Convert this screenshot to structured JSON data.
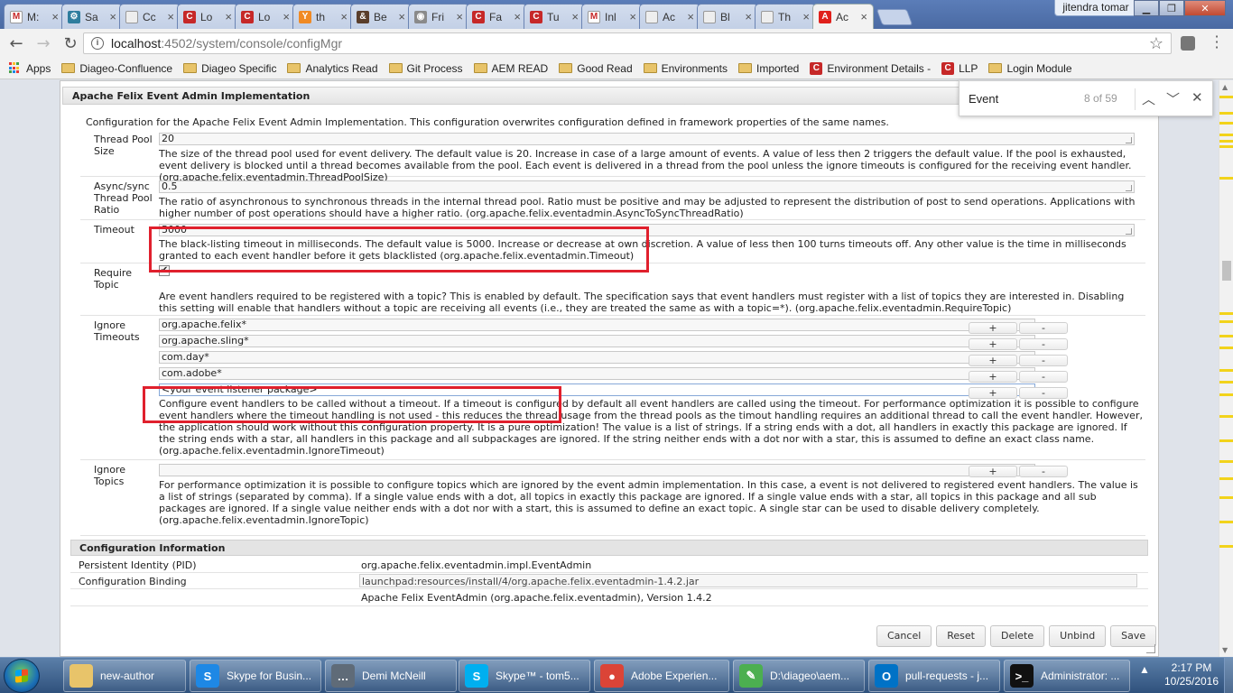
{
  "browser": {
    "tabs": [
      {
        "title": "M:",
        "fav": "gmail-icon",
        "color": "#ffffff",
        "glyph": "M"
      },
      {
        "title": "Sa",
        "fav": "gear-icon",
        "color": "#2e7d9e",
        "glyph": "⚙"
      },
      {
        "title": "Cc",
        "fav": "page-icon",
        "color": "#eeeeee",
        "glyph": ""
      },
      {
        "title": "Lo",
        "fav": "confluence-icon",
        "color": "#c62828",
        "glyph": "C"
      },
      {
        "title": "Lo",
        "fav": "confluence-icon",
        "color": "#c62828",
        "glyph": "C"
      },
      {
        "title": "th",
        "fav": "ycombinator-icon",
        "color": "#f08a24",
        "glyph": "Y"
      },
      {
        "title": "Be",
        "fav": "ampersand-icon",
        "color": "#5a3e2b",
        "glyph": "&"
      },
      {
        "title": "Fri",
        "fav": "eye-icon",
        "color": "#8a8a8a",
        "glyph": "◉"
      },
      {
        "title": "Fa",
        "fav": "confluence-icon",
        "color": "#c62828",
        "glyph": "C"
      },
      {
        "title": "Tu",
        "fav": "confluence-icon",
        "color": "#c62828",
        "glyph": "C"
      },
      {
        "title": "Inl",
        "fav": "gmail-icon",
        "color": "#ffffff",
        "glyph": "M"
      },
      {
        "title": "Ac",
        "fav": "page-icon",
        "color": "#eeeeee",
        "glyph": ""
      },
      {
        "title": "Bl",
        "fav": "page-icon",
        "color": "#eeeeee",
        "glyph": ""
      },
      {
        "title": "Th",
        "fav": "page-icon",
        "color": "#eeeeee",
        "glyph": ""
      },
      {
        "title": "Ac",
        "fav": "adobe-icon",
        "color": "#e0201b",
        "glyph": "A"
      }
    ],
    "user": "jitendra tomar",
    "url_host": "localhost",
    "url_path": ":4502/system/console/configMgr",
    "bookmarks": [
      "Apps",
      "Diageo-Confluence",
      "Diageo Specific",
      "Analytics Read",
      "Git Process",
      "AEM READ",
      "Good Read",
      "Environments",
      "Imported",
      "Environment Details -",
      "LLP",
      "Login Module"
    ]
  },
  "findbar": {
    "query": "Event",
    "count": "8 of 59"
  },
  "dialog": {
    "title": "Apache Felix Event Admin Implementation",
    "intro": "Configuration for the Apache Felix Event Admin Implementation. This configuration overwrites configuration defined in framework properties of the same names.",
    "thread_pool": {
      "label": "Thread Pool Size",
      "value": "20",
      "desc": "The size of the thread pool used for event delivery. The default value is 20. Increase in case of a large amount of events. A value of less then 2 triggers the default value. If the pool is exhausted, event delivery is blocked until a thread becomes available from the pool. Each event is delivered in a thread from the pool unless the ignore timeouts is configured for the receiving event handler. (org.apache.felix.eventadmin.ThreadPoolSize)"
    },
    "async": {
      "label": "Async/sync Thread Pool Ratio",
      "value": "0.5",
      "desc": "The ratio of asynchronous to synchronous threads in the internal thread pool. Ratio must be positive and may be adjusted to represent the distribution of post to send operations. Applications with higher number of post operations should have a higher ratio. (org.apache.felix.eventadmin.AsyncToSyncThreadRatio)"
    },
    "timeout": {
      "label": "Timeout",
      "value": "5000",
      "desc": "The black-listing timeout in milliseconds. The default value is 5000. Increase or decrease at own discretion. A value of less then 100 turns timeouts off. Any other value is the time in milliseconds granted to each event handler before it gets blacklisted (org.apache.felix.eventadmin.Timeout)"
    },
    "require_topic": {
      "label": "Require Topic",
      "checked": true,
      "desc": "Are event handlers required to be registered with a topic? This is enabled by default. The specification says that event handlers must register with a list of topics they are interested in. Disabling this setting will enable that handlers without a topic are receiving all events (i.e., they are treated the same as with a topic=*). (org.apache.felix.eventadmin.RequireTopic)"
    },
    "ignore_timeouts": {
      "label": "Ignore Timeouts",
      "values": [
        "org.apache.felix*",
        "org.apache.sling*",
        "com.day*",
        "com.adobe*",
        "<your event listener package>"
      ],
      "desc": "Configure event handlers to be called without a timeout. If a timeout is configured by default all event handlers are called using the timeout. For performance optimization it is possible to configure event handlers where the timeout handling is not used - this reduces the thread usage from the thread pools as the timout handling requires an additional thread to call the event handler. However, the application should work without this configuration property. It is a pure optimization! The value is a list of strings. If a string ends with a dot, all handlers in exactly this package are ignored. If the string ends with a star, all handlers in this package and all subpackages are ignored. If the string neither ends with a dot nor with a star, this is assumed to define an exact class name. (org.apache.felix.eventadmin.IgnoreTimeout)"
    },
    "ignore_topics": {
      "label": "Ignore Topics",
      "value": "",
      "desc": "For performance optimization it is possible to configure topics which are ignored by the event admin implementation. In this case, a event is not delivered to registered event handlers. The value is a list of strings (separated by comma). If a single value ends with a dot, all topics in exactly this package are ignored. If a single value ends with a star, all topics in this package and all sub packages are ignored. If a single value neither ends with a dot nor with a start, this is assumed to define an exact topic. A single star can be used to disable delivery completely. (org.apache.felix.eventadmin.IgnoreTopic)"
    },
    "plus": "+",
    "minus": "-",
    "config_info": {
      "heading": "Configuration Information",
      "pid_label": "Persistent Identity (PID)",
      "pid_value": "org.apache.felix.eventadmin.impl.EventAdmin",
      "binding_label": "Configuration Binding",
      "binding_value": "launchpad:resources/install/4/org.apache.felix.eventadmin-1.4.2.jar",
      "bundle": "Apache Felix EventAdmin (org.apache.felix.eventadmin), Version 1.4.2"
    },
    "buttons": {
      "cancel": "Cancel",
      "reset": "Reset",
      "delete": "Delete",
      "unbind": "Unbind",
      "save": "Save"
    }
  },
  "taskbar": {
    "items": [
      {
        "label": "",
        "icon": "folder-icon",
        "color": "#e8c46a",
        "glyph": ""
      },
      {
        "label": "new-author",
        "icon": "folder-icon",
        "color": "#e8c46a",
        "glyph": ""
      },
      {
        "label": "Skype for Busin...",
        "icon": "skype-icon",
        "color": "#1e88e5",
        "glyph": "S"
      },
      {
        "label": "Demi McNeill",
        "icon": "chat-icon",
        "color": "#5f6b78",
        "glyph": "…"
      },
      {
        "label": "Skype™ - tom5...",
        "icon": "skype-icon",
        "color": "#00aff0",
        "glyph": "S"
      },
      {
        "label": "Adobe Experien...",
        "icon": "chrome-icon",
        "color": "#db4437",
        "glyph": "●"
      },
      {
        "label": "D:\\diageo\\aem...",
        "icon": "notepad-icon",
        "color": "#4caf50",
        "glyph": "✎"
      },
      {
        "label": "pull-requests - j...",
        "icon": "outlook-icon",
        "color": "#0072c6",
        "glyph": "O"
      },
      {
        "label": "Administrator: ...",
        "icon": "cmd-icon",
        "color": "#111111",
        "glyph": ">_"
      }
    ],
    "time": "2:17 PM",
    "date": "10/25/2016"
  }
}
